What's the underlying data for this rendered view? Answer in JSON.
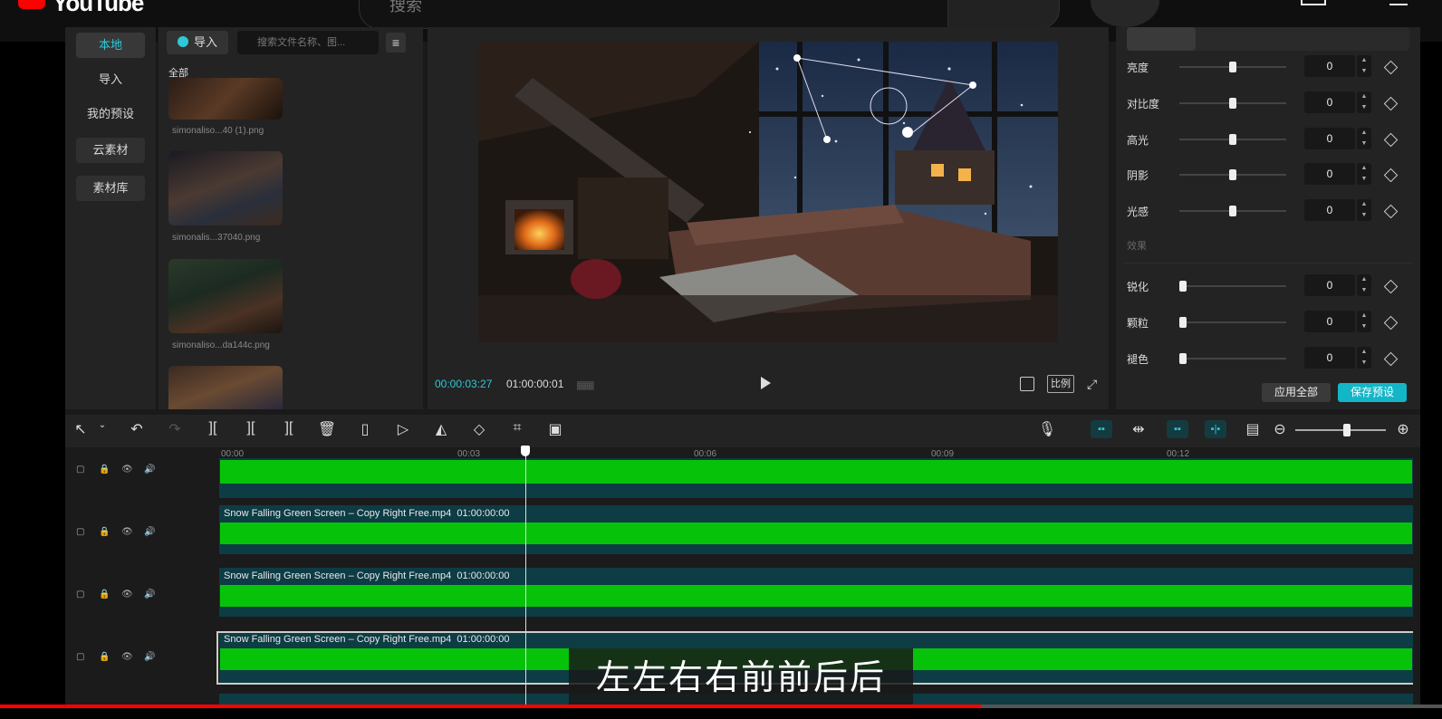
{
  "youtube": {
    "logo_text": "YouTube",
    "search_placeholder": "搜索"
  },
  "media": {
    "nav": [
      "本地",
      "导入",
      "我的预设",
      "云素材",
      "素材库"
    ],
    "import_label": "导入",
    "search_placeholder": "搜索文件名称、图...",
    "all_label": "全部",
    "files": [
      "simonaliso...40 (1).png",
      "simonalis...37040.png",
      "simonaliso...da144c.png",
      ""
    ]
  },
  "preview": {
    "time_current": "00:00:03:27",
    "time_total": "01:00:00:01",
    "ratio_label": "比例"
  },
  "adjust": {
    "sliders": [
      {
        "label": "亮度",
        "value": "0",
        "level": 0.5
      },
      {
        "label": "对比度",
        "value": "0",
        "level": 0.5
      },
      {
        "label": "高光",
        "value": "0",
        "level": 0.5
      },
      {
        "label": "阴影",
        "value": "0",
        "level": 0.5
      },
      {
        "label": "光感",
        "value": "0",
        "level": 0.5
      }
    ],
    "effects_label": "效果",
    "effects": [
      {
        "label": "锐化",
        "value": "0",
        "level": 0
      },
      {
        "label": "颗粒",
        "value": "0",
        "level": 0
      },
      {
        "label": "褪色",
        "value": "0",
        "level": 0
      }
    ],
    "apply_all": "应用全部",
    "save_preset": "保存预设"
  },
  "timeline": {
    "ruler": [
      "00:00",
      "00:03",
      "00:06",
      "00:09",
      "00:12"
    ],
    "clips": [
      {
        "title": "",
        "duration": ""
      },
      {
        "title": "Snow Falling Green Screen – Copy Right Free.mp4",
        "duration": "01:00:00:00"
      },
      {
        "title": "Snow Falling Green Screen – Copy Right Free.mp4",
        "duration": "01:00:00:00"
      },
      {
        "title": "Snow Falling Green Screen – Copy Right Free.mp4",
        "duration": "01:00:00:00"
      }
    ]
  },
  "subtitle": "左左右右前前后后",
  "colors": {
    "accent": "#2fc8d8",
    "clip_green": "#06c30a",
    "clip_bg": "#0d3c45",
    "youtube_red": "#ff0000"
  },
  "video_progress": 0.68
}
